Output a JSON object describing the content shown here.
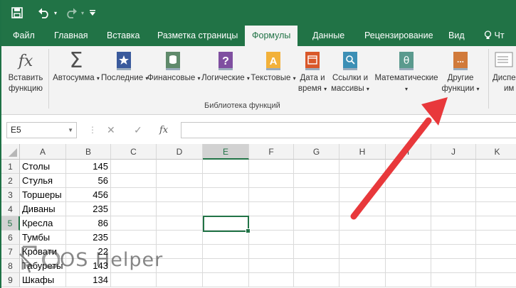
{
  "quick_access": {
    "save_icon": "save-icon",
    "undo_icon": "undo-icon",
    "redo_icon": "redo-icon",
    "customize_icon": "customize-icon"
  },
  "tabs": [
    {
      "label": "Файл",
      "active": false
    },
    {
      "label": "Главная",
      "active": false
    },
    {
      "label": "Вставка",
      "active": false
    },
    {
      "label": "Разметка страницы",
      "active": false
    },
    {
      "label": "Формулы",
      "active": true
    },
    {
      "label": "Данные",
      "active": false
    },
    {
      "label": "Рецензирование",
      "active": false
    },
    {
      "label": "Вид",
      "active": false
    }
  ],
  "tell_me_fragment": "Чт",
  "ribbon": {
    "insert_function": {
      "line1": "Вставить",
      "line2": "функцию"
    },
    "autosum": {
      "label": "Автосумма"
    },
    "recent": {
      "label": "Последние"
    },
    "financial": {
      "label": "Финансовые"
    },
    "logical": {
      "label": "Логические"
    },
    "text": {
      "label": "Текстовые"
    },
    "datetime": {
      "line1": "Дата и",
      "line2": "время"
    },
    "lookup": {
      "line1": "Ссылки и",
      "line2": "массивы"
    },
    "math": {
      "label": "Математические"
    },
    "more": {
      "line1": "Другие",
      "line2": "функции"
    },
    "name_manager": {
      "line1": "Диспе",
      "line2": "им"
    },
    "group_label": "Библиотека функций",
    "colors": {
      "recent": "#3a5a9c",
      "financial": "#5f8a6b",
      "logical": "#7f4fa0",
      "text": "#f2b13a",
      "datetime": "#d9582a",
      "lookup": "#3c8fb5",
      "math": "#5b9a8e",
      "more": "#d17a3a"
    }
  },
  "formula_bar": {
    "name_box": "E5",
    "fx_label": "fx",
    "value": ""
  },
  "columns": [
    "A",
    "B",
    "C",
    "D",
    "E",
    "F",
    "G",
    "H",
    "I",
    "J",
    "K"
  ],
  "selected_column": "E",
  "rows": [
    {
      "num": "1",
      "a": "Столы",
      "b": "145"
    },
    {
      "num": "2",
      "a": "Стулья",
      "b": "56"
    },
    {
      "num": "3",
      "a": "Торшеры",
      "b": "456"
    },
    {
      "num": "4",
      "a": "Диваны",
      "b": "235"
    },
    {
      "num": "5",
      "a": "Кресла",
      "b": "86"
    },
    {
      "num": "6",
      "a": "Тумбы",
      "b": "235"
    },
    {
      "num": "7",
      "a": "Кровати",
      "b": "22"
    },
    {
      "num": "8",
      "a": "Табуреты",
      "b": "143"
    },
    {
      "num": "9",
      "a": "Шкафы",
      "b": "134"
    }
  ],
  "selected_row": "5",
  "annotation": {
    "arrow_color": "#e8383b"
  },
  "watermark": {
    "text": "OS Helper"
  },
  "colors": {
    "excel_green": "#217346",
    "ribbon_bg": "#f3f3f3"
  }
}
